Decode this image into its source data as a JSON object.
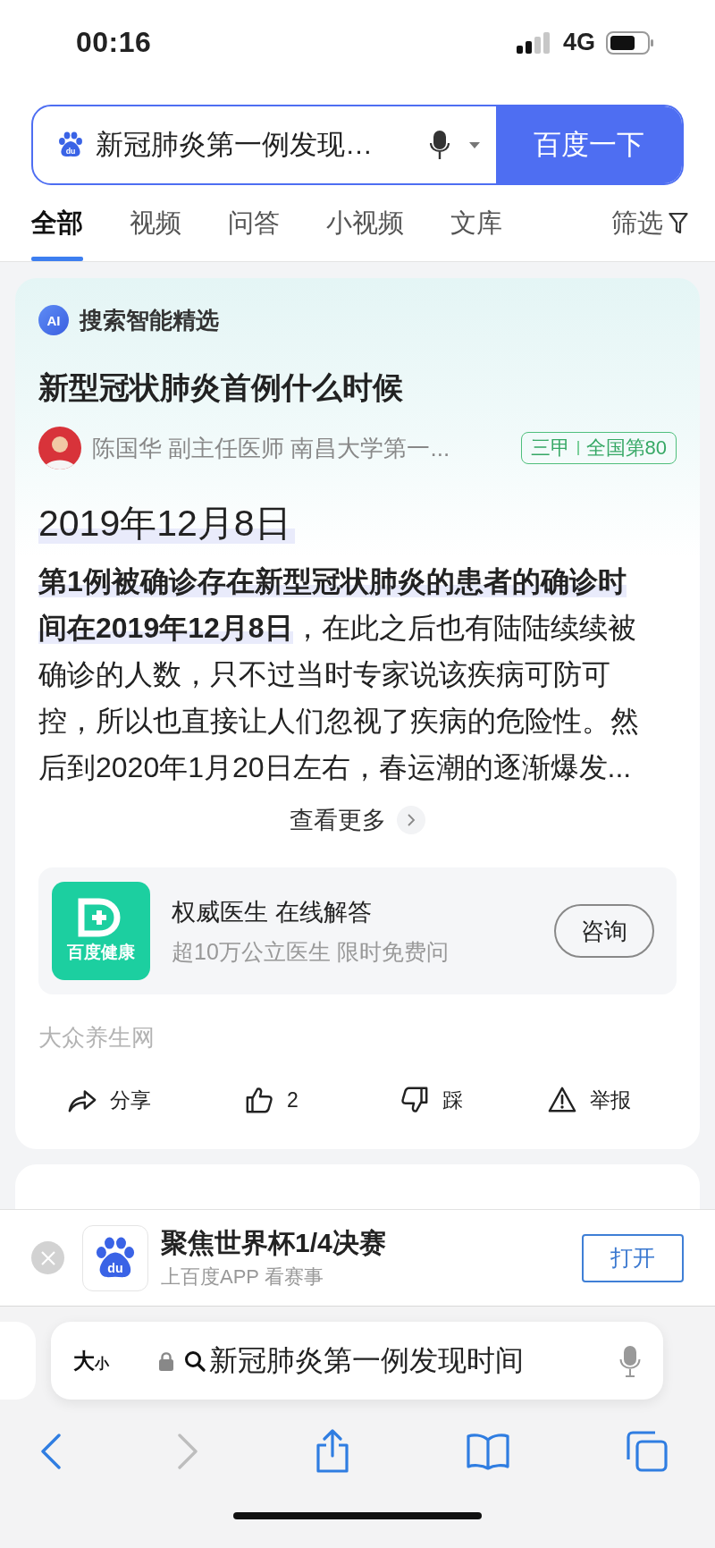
{
  "status_bar": {
    "time": "00:16",
    "network": "4G"
  },
  "search": {
    "logo_text": "du",
    "query": "新冠肺炎第一例发现…",
    "button": "百度一下"
  },
  "tabs": [
    {
      "label": "全部",
      "selected": true
    },
    {
      "label": "视频",
      "selected": false
    },
    {
      "label": "问答",
      "selected": false
    },
    {
      "label": "小视频",
      "selected": false
    },
    {
      "label": "文库",
      "selected": false
    }
  ],
  "filter": {
    "label": "筛选"
  },
  "answer_card": {
    "ai_badge": "AI",
    "header": "搜索智能精选",
    "question": "新型冠状肺炎首例什么时候",
    "author": "陈国华 副主任医师 南昌大学第一...",
    "hospital_tags": [
      "三甲",
      "全国第80"
    ],
    "answer_title": "2019年12月8日",
    "answer_text": "**第1例被确诊存在新型冠状肺炎的患者的确诊时间在2019年12月8日**，在此之后也有陆陆续续被确诊的人数，只不过当时专家说该疾病可防可控，所以也直接让人们忽视了疾病的危险性。然后到2020年1月20日左右，春运潮的逐渐爆发...",
    "more": "查看更多",
    "promo": {
      "logo_text": "百度健康",
      "title": "权威医生 在线解答",
      "subtitle": "超10万公立医生 限时免费问",
      "button": "咨询"
    },
    "source": "大众养生网",
    "actions": [
      {
        "kind": "share",
        "label": "分享"
      },
      {
        "kind": "like",
        "label": "2"
      },
      {
        "kind": "dislike",
        "label": "踩"
      },
      {
        "kind": "report",
        "label": "举报"
      }
    ]
  },
  "app_banner": {
    "logo_text": "du",
    "title": "聚焦世界杯1/4决赛",
    "subtitle": "上百度APP 看赛事",
    "button": "打开"
  },
  "browser": {
    "text_size_large": "大",
    "text_size_small": "小",
    "address": "新冠肺炎第一例发现时间"
  }
}
